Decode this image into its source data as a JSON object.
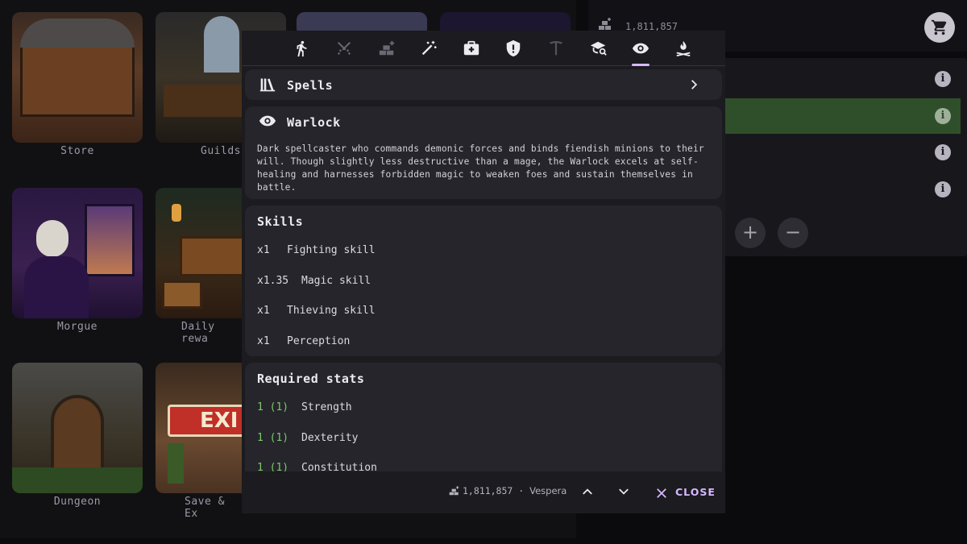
{
  "background": {
    "tiles": [
      {
        "label": "Store"
      },
      {
        "label": "Guilds"
      },
      {
        "label": ""
      },
      {
        "label": ""
      },
      {
        "label": "Morgue"
      },
      {
        "label": "Daily rewa"
      },
      {
        "label": "Dungeon"
      },
      {
        "label": "Save & Ex"
      }
    ],
    "gold_amount": "1,811,857"
  },
  "dialog": {
    "tabs": [
      {
        "icon": "walking-person-icon"
      },
      {
        "icon": "crossed-swords-icon"
      },
      {
        "icon": "gold-bars-icon"
      },
      {
        "icon": "magic-wand-icon"
      },
      {
        "icon": "medkit-icon"
      },
      {
        "icon": "shield-icon"
      },
      {
        "icon": "pickaxe-icon"
      },
      {
        "icon": "school-search-icon"
      },
      {
        "icon": "eye-icon",
        "active": true
      },
      {
        "icon": "campfire-icon"
      }
    ],
    "spells_label": "Spells",
    "class_name": "Warlock",
    "class_description": "Dark spellcaster who commands demonic forces and binds fiendish minions to their will. Though slightly less destructive than a mage, the Warlock excels at self-healing and harnesses forbidden magic to weaken foes and sustain themselves in battle.",
    "skills_title": "Skills",
    "skills": [
      {
        "multiplier": "x1",
        "name": "Fighting skill"
      },
      {
        "multiplier": "x1.35",
        "name": "Magic skill"
      },
      {
        "multiplier": "x1",
        "name": "Thieving skill"
      },
      {
        "multiplier": "x1",
        "name": "Perception"
      }
    ],
    "required_stats_title": "Required stats",
    "required_stats": [
      {
        "value": "1 (1)",
        "name": "Strength"
      },
      {
        "value": "1 (1)",
        "name": "Dexterity"
      },
      {
        "value": "1 (1)",
        "name": "Constitution"
      }
    ],
    "footer": {
      "gold": "1,811,857",
      "separator": "·",
      "character": "Vespera",
      "close_label": "CLOSE"
    }
  },
  "colors": {
    "accent": "#d8b8ff",
    "required_green": "#7bc96b",
    "highlight_row": "#2f4f2a"
  }
}
